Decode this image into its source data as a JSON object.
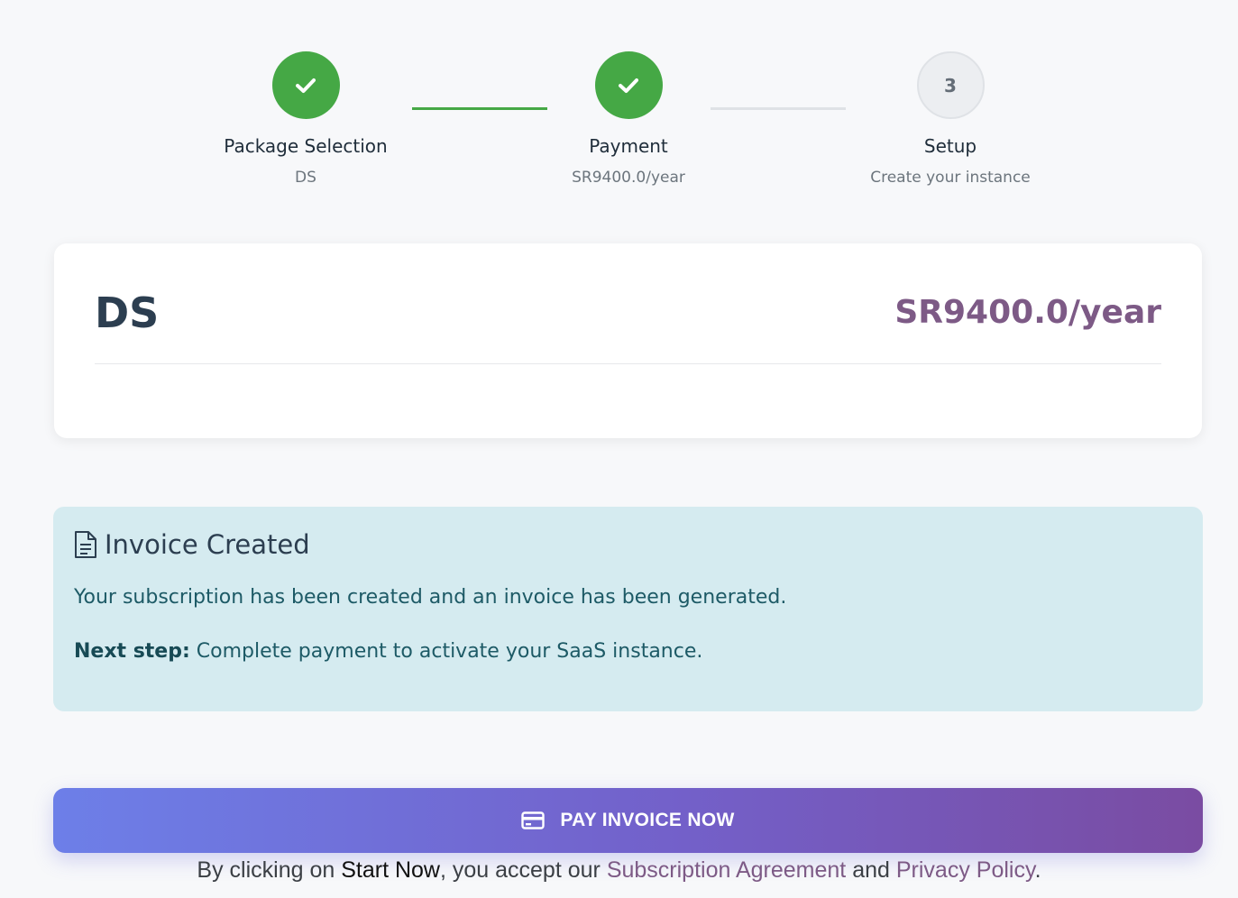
{
  "stepper": {
    "steps": [
      {
        "title": "Package Selection",
        "subtitle": "DS",
        "state": "done",
        "icon": "check-icon"
      },
      {
        "title": "Payment",
        "subtitle": "SR9400.0/year",
        "state": "done",
        "icon": "check-icon"
      },
      {
        "title": "Setup",
        "subtitle": "Create your instance",
        "state": "pending",
        "number": "3"
      }
    ]
  },
  "package": {
    "name": "DS",
    "price": "SR9400.0/year"
  },
  "alert": {
    "icon": "document-icon",
    "title": "Invoice Created",
    "message": "Your subscription has been created and an invoice has been generated.",
    "next_label": "Next step:",
    "next_text": " Complete payment to activate your SaaS instance."
  },
  "pay_button": {
    "icon": "credit-card-icon",
    "label": "PAY INVOICE NOW"
  },
  "terms": {
    "prefix": "By clicking on ",
    "action": "Start Now",
    "middle": ", you accept our ",
    "subscription_link": "Subscription Agreement",
    "conjunction": " and ",
    "privacy_link": "Privacy Policy",
    "suffix": "."
  },
  "colors": {
    "success": "#45a845",
    "accent": "#7d5a86",
    "alert_bg": "#d5ebf0",
    "button_gradient_start": "#6d7fe8",
    "button_gradient_end": "#7a4ca2"
  }
}
